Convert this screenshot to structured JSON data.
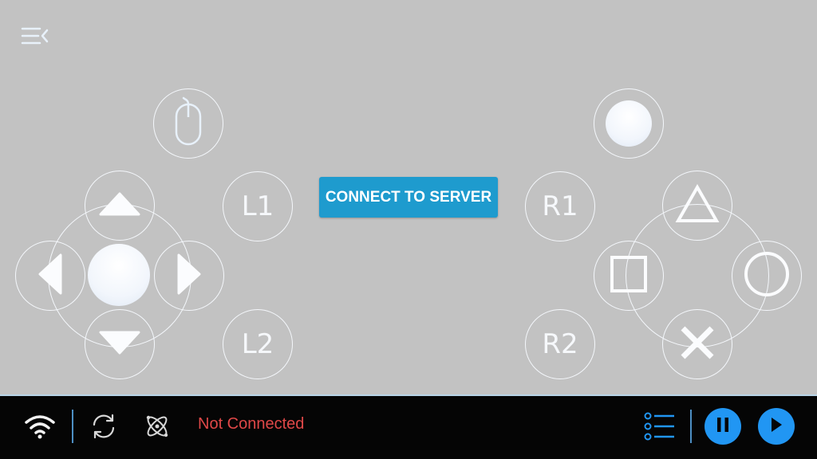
{
  "menu": {
    "icon": "menu-collapse-icon"
  },
  "dpad": {
    "up_icon": "triangle-up-icon",
    "down_icon": "triangle-down-icon",
    "left_icon": "triangle-left-icon",
    "right_icon": "triangle-right-icon"
  },
  "left_stick": {
    "icon": "mouse-icon"
  },
  "shoulders": {
    "l1": "L1",
    "l2": "L2",
    "r1": "R1",
    "r2": "R2"
  },
  "connect_button": {
    "label": "CONNECT TO SERVER"
  },
  "face_buttons": {
    "triangle_icon": "triangle-icon",
    "square_icon": "square-icon",
    "circle_icon": "circle-icon",
    "cross_icon": "cross-icon"
  },
  "bottom_bar": {
    "status_text": "Not Connected",
    "status_color": "#e04848",
    "wifi_icon": "wifi-icon",
    "refresh_icon": "refresh-icon",
    "network_icon": "network-icon",
    "list_icon": "list-icon",
    "pause_icon": "pause-icon",
    "play_icon": "play-icon",
    "accent_color": "#2196f3"
  }
}
